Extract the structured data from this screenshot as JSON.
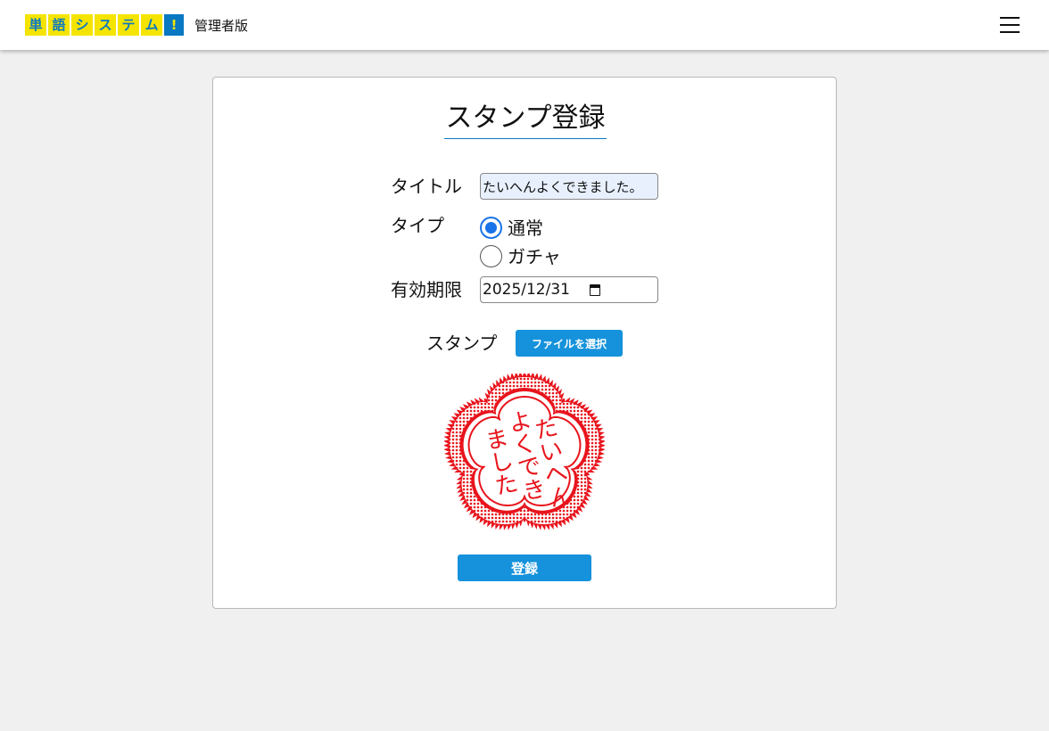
{
  "header": {
    "logo_chars": [
      "単",
      "語",
      "シ",
      "ス",
      "テ",
      "ム",
      "!"
    ],
    "admin_label": "管理者版",
    "menu_icon": "hamburger-menu-icon"
  },
  "form": {
    "title": "スタンプ登録",
    "title_label": "タイトル",
    "title_value": "たいへんよくできました。",
    "type_label": "タイプ",
    "type_options": [
      "通常",
      "ガチャ"
    ],
    "type_selected": "通常",
    "expiry_label": "有効期限",
    "expiry_value": "2025/12/31",
    "stamp_label": "スタンプ",
    "file_button": "ファイルを選択",
    "submit_button": "登録"
  },
  "stamp_preview": {
    "text_columns": [
      "たいへん",
      "よくでき",
      "ました"
    ],
    "color": "#e8141c"
  },
  "colors": {
    "accent": "#1592db",
    "logo_yellow": "#f5e400",
    "logo_blue": "#0a78c2"
  }
}
